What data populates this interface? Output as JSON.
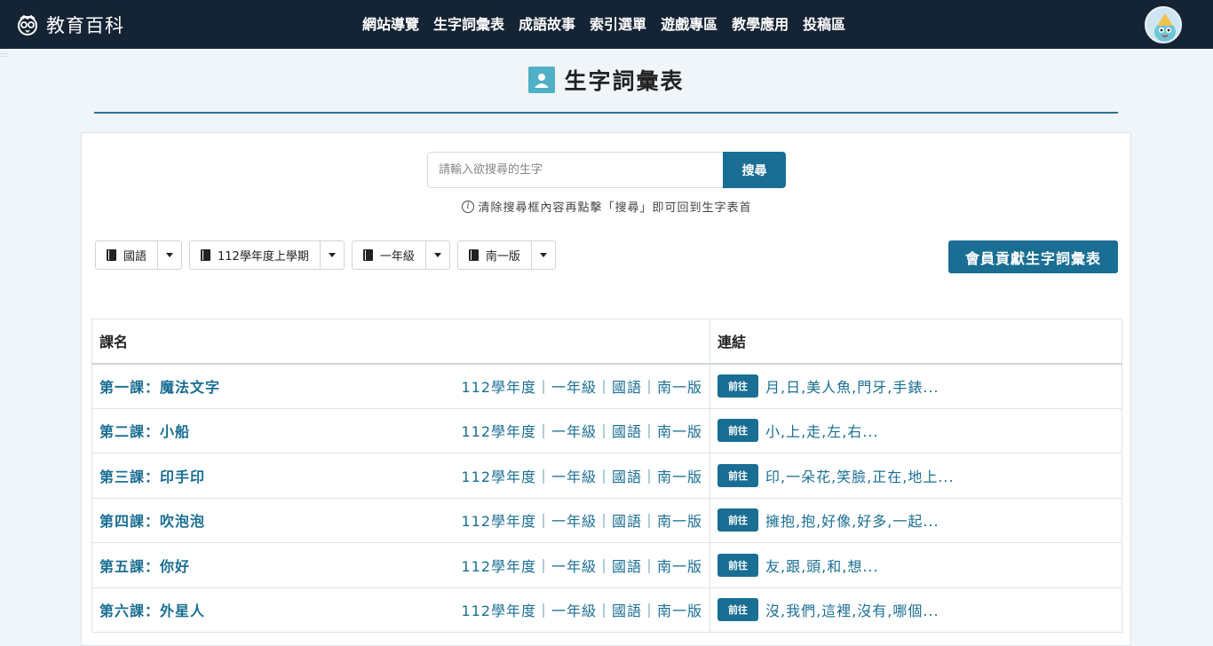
{
  "nav": {
    "brand": "教育百科",
    "items": [
      "網站導覽",
      "生字詞彙表",
      "成語故事",
      "索引選單",
      "遊戲專區",
      "教學應用",
      "投稿區"
    ]
  },
  "page": {
    "title": "生字詞彙表"
  },
  "search": {
    "placeholder": "請輸入欲搜尋的生字",
    "button": "搜尋",
    "hint": "清除搜尋框內容再點擊「搜尋」即可回到生字表首"
  },
  "filters": [
    "國語",
    "112學年度上學期",
    "一年級",
    "南一版"
  ],
  "contribute_label": "會員貢獻生字詞彙表",
  "table": {
    "headers": [
      "課名",
      "連結"
    ],
    "go_label": "前往",
    "rows": [
      {
        "title": "第一課：魔法文字",
        "meta": "112學年度｜一年級｜國語｜南一版",
        "words": "月,日,美人魚,門牙,手錶..."
      },
      {
        "title": "第二課：小船",
        "meta": "112學年度｜一年級｜國語｜南一版",
        "words": "小,上,走,左,右..."
      },
      {
        "title": "第三課：印手印",
        "meta": "112學年度｜一年級｜國語｜南一版",
        "words": "印,一朵花,笑臉,正在,地上..."
      },
      {
        "title": "第四課：吹泡泡",
        "meta": "112學年度｜一年級｜國語｜南一版",
        "words": "擁抱,抱,好像,好多,一起..."
      },
      {
        "title": "第五課：你好",
        "meta": "112學年度｜一年級｜國語｜南一版",
        "words": "友,跟,頭,和,想..."
      },
      {
        "title": "第六課：外星人",
        "meta": "112學年度｜一年級｜國語｜南一版",
        "words": "沒,我們,這裡,沒有,哪個..."
      }
    ]
  },
  "colors": {
    "navbar": "#152434",
    "accent": "#1a6e94",
    "title_icon": "#4fb0c6"
  }
}
